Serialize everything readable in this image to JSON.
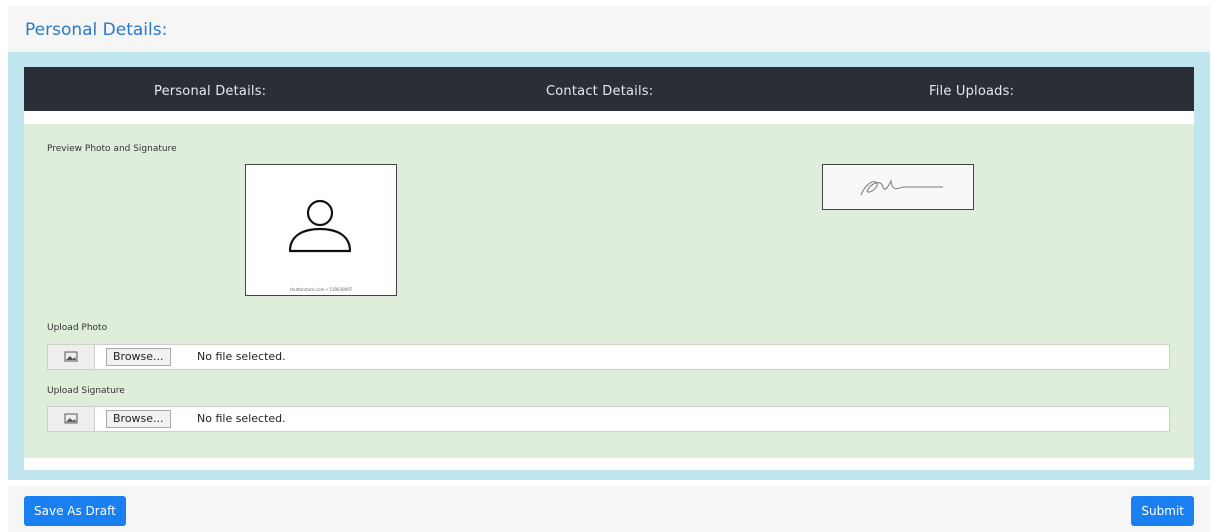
{
  "page_title": "Personal Details:",
  "tabs": [
    "Personal Details:",
    "Contact Details:",
    "File Uploads:"
  ],
  "preview_label": "Preview Photo and Signature",
  "photo_caption": "shutterstock.com • 519039097",
  "upload_photo": {
    "label": "Upload Photo",
    "browse_label": "Browse...",
    "status": "No file selected."
  },
  "upload_signature": {
    "label": "Upload Signature",
    "browse_label": "Browse...",
    "status": "No file selected."
  },
  "buttons": {
    "save_draft": "Save As Draft",
    "submit": "Submit"
  },
  "colors": {
    "accent": "#1a7ff0",
    "tabbar": "#2a2f37",
    "panel_bg": "#dfeeda",
    "outer_bg": "#bfe6ee",
    "title": "#2a78c9"
  }
}
